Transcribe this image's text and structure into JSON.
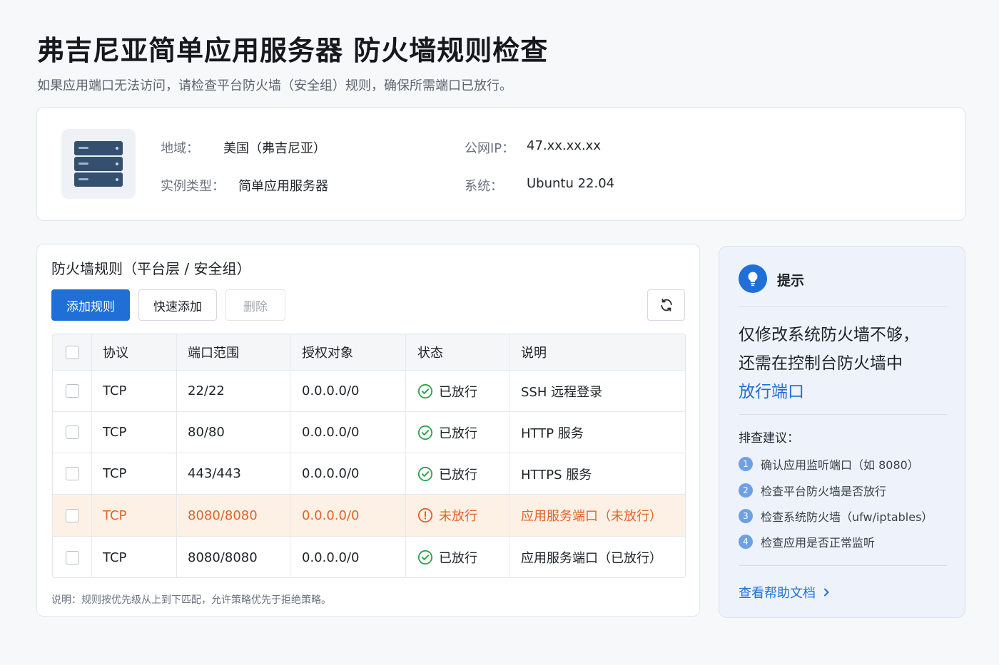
{
  "header": {
    "title": "弗吉尼亚简单应用服务器 防火墙规则检查",
    "subtitle": "如果应用端口无法访问，请检查平台防火墙（安全组）规则，确保所需端口已放行。"
  },
  "instance": {
    "region_label": "地域：",
    "region_value": "美国（弗吉尼亚）",
    "type_label": "实例类型：",
    "type_value": "简单应用服务器",
    "ip_label": "公网IP：",
    "ip_value": "47.xx.xx.xx",
    "os_label": "系统：",
    "os_value": "Ubuntu 22.04",
    "icon": "server-icon"
  },
  "rules": {
    "title": "防火墙规则（平台层 / 安全组）",
    "add_label": "添加规则",
    "quick_add_label": "快速添加",
    "delete_label": "删除",
    "refresh_icon": "refresh-icon",
    "columns": [
      "协议",
      "端口范围",
      "授权对象",
      "状态",
      "说明"
    ],
    "rows": [
      {
        "protocol": "TCP",
        "port": "22/22",
        "source": "0.0.0.0/0",
        "status": "已放行",
        "note": "SSH 远程登录"
      },
      {
        "protocol": "TCP",
        "port": "80/80",
        "source": "0.0.0.0/0",
        "status": "已放行",
        "note": "HTTP 服务"
      },
      {
        "protocol": "TCP",
        "port": "443/443",
        "source": "0.0.0.0/0",
        "status": "已放行",
        "note": "HTTPS 服务"
      },
      {
        "protocol": "TCP",
        "port": "8080/8080",
        "source": "0.0.0.0/0",
        "status": "未放行",
        "note": "应用服务端口（未放行）"
      },
      {
        "protocol": "TCP",
        "port": "8080/8080",
        "source": "0.0.0.0/0",
        "status": "已放行",
        "note": "应用服务端口（已放行）"
      }
    ],
    "footnote": "说明：规则按优先级从上到下匹配，允许策略优先于拒绝策略。"
  },
  "tips": {
    "title": "提示",
    "msg_line1": "仅修改系统防火墙不够，",
    "msg_line2": "还需在控制台防火墙中",
    "msg_highlight": "放行端口",
    "sub_title": "排查建议：",
    "steps": [
      {
        "num": "1",
        "text": "确认应用监听端口（如 8080）"
      },
      {
        "num": "2",
        "text": "检查平台防火墙是否放行"
      },
      {
        "num": "3",
        "text": "检查系统防火墙（ufw/iptables）"
      },
      {
        "num": "4",
        "text": "检查应用是否正常监听"
      }
    ],
    "link_label": "查看帮助文档",
    "link_icon": "chevron-right-icon"
  },
  "colors": {
    "primary": "#1f6fd6",
    "success": "#2ea44f",
    "warning": "#e0642a",
    "warning_bg": "#fdf1e6"
  }
}
